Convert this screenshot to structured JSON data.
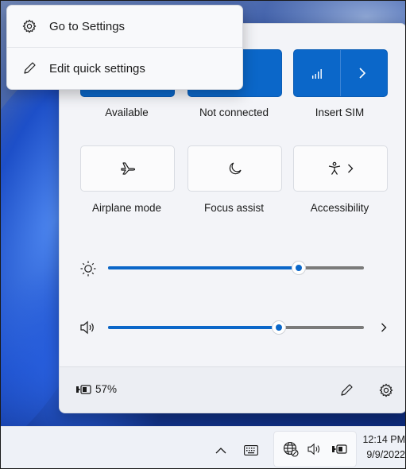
{
  "context_menu": {
    "items": [
      {
        "label": "Go to Settings",
        "icon": "gear-icon"
      },
      {
        "label": "Edit quick settings",
        "icon": "pencil-icon"
      }
    ]
  },
  "quick_settings": {
    "tiles_row1": [
      {
        "label": "Available",
        "state": "on",
        "icon": "wifi-icon"
      },
      {
        "label": "Not connected",
        "state": "on",
        "icon": "bluetooth-icon"
      },
      {
        "label": "Insert SIM",
        "state": "on",
        "icon": "cellular-signal-icon"
      }
    ],
    "tiles_row2": [
      {
        "label": "Airplane mode",
        "state": "off",
        "icon": "airplane-icon"
      },
      {
        "label": "Focus assist",
        "state": "off",
        "icon": "moon-icon"
      },
      {
        "label": "Accessibility",
        "state": "off",
        "icon": "accessibility-icon"
      }
    ],
    "brightness": {
      "level": 0.74,
      "icon": "sun-icon"
    },
    "volume": {
      "level": 0.67,
      "icon": "speaker-icon"
    },
    "battery": {
      "percent_label": "57%",
      "icon": "battery-charging-icon"
    },
    "colors": {
      "accent": "#0b67c9",
      "panel": "#f3f4f8"
    }
  },
  "taskbar": {
    "time": "12:14 PM",
    "date": "9/9/2022",
    "tray_icons": [
      "chevron-up-icon",
      "keyboard-icon",
      "globe-icon",
      "speaker-icon",
      "battery-charging-icon"
    ]
  }
}
